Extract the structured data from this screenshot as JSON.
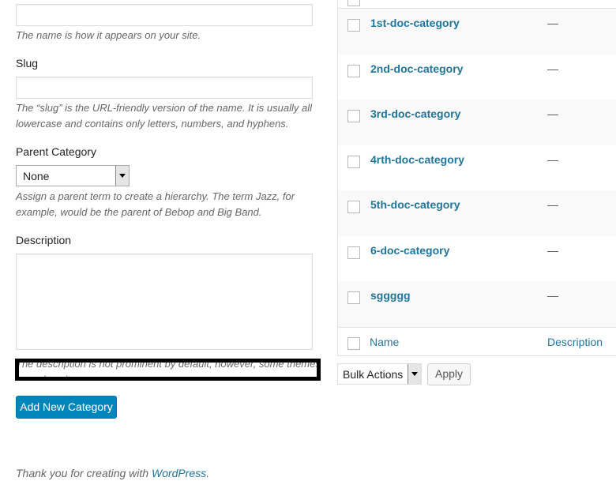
{
  "form": {
    "name_help": "The name is how it appears on your site.",
    "slug_label": "Slug",
    "slug_help": "The “slug” is the URL-friendly version of the name. It is usually all lowercase and contains only letters, numbers, and hyphens.",
    "parent_label": "Parent Category",
    "parent_value": "None",
    "parent_help": "Assign a parent term to create a hierarchy. The term Jazz, for example, would be the parent of Bebop and Big Band.",
    "description_label": "Description",
    "description_help": "The description is not prominent by default; however, some themes may show it.",
    "submit_label": "Add New Category"
  },
  "table": {
    "rows": [
      {
        "name": "1st-doc-category",
        "description": "—"
      },
      {
        "name": "2nd-doc-category",
        "description": "—"
      },
      {
        "name": "3rd-doc-category",
        "description": "—"
      },
      {
        "name": "4rth-doc-category",
        "description": "—"
      },
      {
        "name": "5th-doc-category",
        "description": "—"
      },
      {
        "name": "6-doc-category",
        "description": "—"
      },
      {
        "name": "sggggg",
        "description": "—"
      }
    ],
    "footer": {
      "name": "Name",
      "description": "Description"
    },
    "bulk_actions": "Bulk Actions",
    "apply": "Apply"
  },
  "footer": {
    "text": "Thank you for creating with ",
    "link": "WordPress",
    "end": "."
  }
}
